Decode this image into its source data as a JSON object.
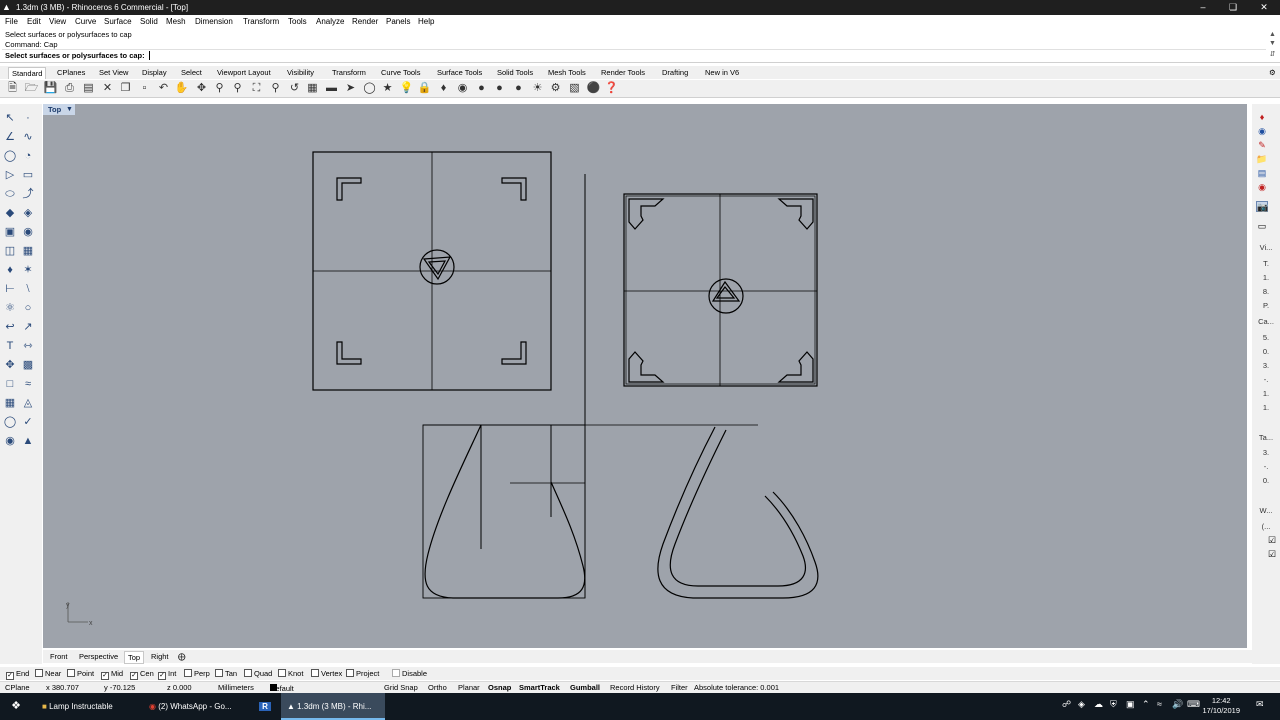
{
  "titlebar": {
    "title": "1.3dm (3 MB) - Rhinoceros 6 Commercial - [Top]",
    "minimize": "–",
    "maximize": "❏",
    "close": "✕"
  },
  "menu": [
    "File",
    "Edit",
    "View",
    "Curve",
    "Surface",
    "Solid",
    "Mesh",
    "Dimension",
    "Transform",
    "Tools",
    "Analyze",
    "Render",
    "Panels",
    "Help"
  ],
  "command": {
    "history_1": "Select surfaces or polysurfaces to cap",
    "history_2": "Command: Cap",
    "prompt": "Select surfaces or polysurfaces to cap:"
  },
  "toolbar_tabs": [
    "Standard",
    "CPlanes",
    "Set View",
    "Display",
    "Select",
    "Viewport Layout",
    "Visibility",
    "Transform",
    "Curve Tools",
    "Surface Tools",
    "Solid Tools",
    "Mesh Tools",
    "Render Tools",
    "Drafting",
    "New in V6"
  ],
  "viewport": {
    "label": "Top",
    "axis_y": "y",
    "axis_x": "x"
  },
  "right_panel": [
    "Vi...",
    "T.",
    "1.",
    "8.",
    "P.",
    "Ca...",
    "5.",
    "0.",
    "3.",
    "-.",
    "1.",
    "1.",
    "Ta...",
    "3.",
    "-.",
    "0.",
    "W...",
    "(..."
  ],
  "viewport_tabs": [
    "Front",
    "Perspective",
    "Top",
    "Right"
  ],
  "osnap": [
    {
      "label": "End",
      "checked": true
    },
    {
      "label": "Near",
      "checked": false
    },
    {
      "label": "Point",
      "checked": false
    },
    {
      "label": "Mid",
      "checked": true
    },
    {
      "label": "Cen",
      "checked": true
    },
    {
      "label": "Int",
      "checked": true
    },
    {
      "label": "Perp",
      "checked": false
    },
    {
      "label": "Tan",
      "checked": false
    },
    {
      "label": "Quad",
      "checked": false
    },
    {
      "label": "Knot",
      "checked": false
    },
    {
      "label": "Vertex",
      "checked": false
    },
    {
      "label": "Project",
      "checked": false
    },
    {
      "label": "Disable",
      "checked": false
    }
  ],
  "status": {
    "cplane": "CPlane",
    "x": "x 380.707",
    "y": "y -70.125",
    "z": "z 0.000",
    "units": "Millimeters",
    "layer": "Default",
    "grid_snap": "Grid Snap",
    "ortho": "Ortho",
    "planar": "Planar",
    "osnap": "Osnap",
    "smarttrack": "SmartTrack",
    "gumball": "Gumball",
    "record_history": "Record History",
    "filter": "Filter",
    "tolerance": "Absolute tolerance: 0.001"
  },
  "taskbar": {
    "items": [
      "Lamp Instructable",
      "(2) WhatsApp - Go...",
      "1.3dm (3 MB) - Rhi..."
    ],
    "time": "12:42",
    "date": "17/10/2019"
  },
  "colors": {
    "viewport_bg": "#9ea3ab",
    "titlebar_bg": "#1f1f1f",
    "taskbar_bg": "#101820",
    "active_view_label": "#c9d6e8"
  }
}
